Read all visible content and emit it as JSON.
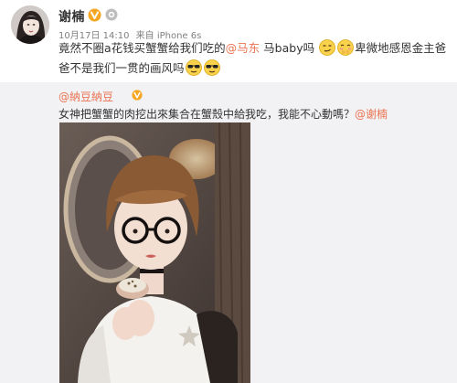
{
  "post": {
    "author_name": "谢楠",
    "avatar_icon": "profile-photo",
    "verified_icon": "yellow-v-badge",
    "member_icon": "weibo-member-icon",
    "date": "10月17日 14:10",
    "source": "来自 iPhone 6s",
    "text_part1": "竟然不圈a花钱买蟹蟹给我们吃的",
    "mention1": "@马东",
    "text_part2": " 马baby吗",
    "text_part3": "卑微地感恩金主爸爸不是我们一贯的画风吗",
    "emojis": [
      "smirk-emoji",
      "shy-emoji",
      "sunglasses-emoji",
      "sunglasses-emoji"
    ]
  },
  "repost": {
    "author": "@納豆納豆",
    "badge_icon": "yellow-v-badge",
    "text": "女神把蟹蟹的肉挖出來集合在蟹殼中給我吃，我能不心動嗎？",
    "mention": "@谢楠",
    "photo_icon": "repost-photo-woman-eating-crab"
  },
  "colors": {
    "link": "#eb7350",
    "badge": "#f5a623",
    "card_bg": "#f2f2f5"
  }
}
